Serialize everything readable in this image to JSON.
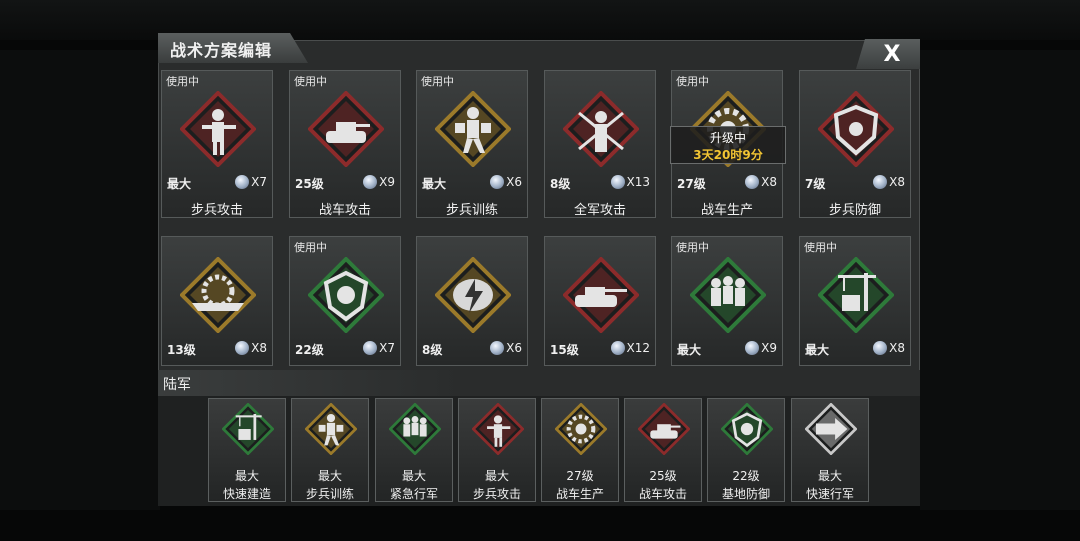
{
  "title": "战术方案编辑",
  "close_label": "X",
  "in_use_label": "使用中",
  "upgrade": {
    "status": "升级中",
    "time": "3天20时9分"
  },
  "army_label": "陆军",
  "colors": {
    "red": "#8c2b2b",
    "gold": "#9b7a2a",
    "green": "#2e7a3a",
    "silver": "#c8c8c8"
  },
  "cards_row1": [
    {
      "in_use": "使用中",
      "level": "最大",
      "count": "X7",
      "name": "步兵攻击",
      "frame": "red",
      "icon": "soldier-aiming-icon"
    },
    {
      "in_use": "使用中",
      "level": "25级",
      "count": "X9",
      "name": "战车攻击",
      "frame": "red",
      "icon": "tank-firing-icon"
    },
    {
      "in_use": "使用中",
      "level": "最大",
      "count": "X6",
      "name": "步兵训练",
      "frame": "gold",
      "icon": "soldier-running-icon"
    },
    {
      "in_use": "",
      "level": "8级",
      "count": "X13",
      "name": "全军攻击",
      "frame": "red",
      "icon": "crossed-rifles-soldier-icon"
    },
    {
      "in_use": "使用中",
      "level": "27级",
      "count": "X8",
      "name": "战车生产",
      "frame": "gold",
      "icon": "gear-production-icon"
    },
    {
      "in_use": "",
      "level": "7级",
      "count": "X8",
      "name": "步兵防御",
      "frame": "red",
      "icon": "shield-defense-icon"
    }
  ],
  "cards_row2": [
    {
      "in_use": "",
      "level": "13级",
      "count": "X8",
      "name": "",
      "frame": "gold",
      "icon": "warship-gear-icon"
    },
    {
      "in_use": "使用中",
      "level": "22级",
      "count": "X7",
      "name": "",
      "frame": "green",
      "icon": "lion-shield-icon"
    },
    {
      "in_use": "",
      "level": "8级",
      "count": "X6",
      "name": "",
      "frame": "gold",
      "icon": "lightning-shield-icon"
    },
    {
      "in_use": "",
      "level": "15级",
      "count": "X12",
      "name": "",
      "frame": "red",
      "icon": "tank-speed-icon"
    },
    {
      "in_use": "使用中",
      "level": "最大",
      "count": "X9",
      "name": "",
      "frame": "green",
      "icon": "soldiers-march-icon"
    },
    {
      "in_use": "使用中",
      "level": "最大",
      "count": "X8",
      "name": "",
      "frame": "green",
      "icon": "crane-construction-icon"
    }
  ],
  "army_slots": [
    {
      "level": "最大",
      "name": "快速建造",
      "frame": "green",
      "icon": "crane-construction-icon"
    },
    {
      "level": "最大",
      "name": "步兵训练",
      "frame": "gold",
      "icon": "soldier-running-icon"
    },
    {
      "level": "最大",
      "name": "紧急行军",
      "frame": "green",
      "icon": "soldiers-march-icon"
    },
    {
      "level": "最大",
      "name": "步兵攻击",
      "frame": "red",
      "icon": "soldier-aiming-icon"
    },
    {
      "level": "27级",
      "name": "战车生产",
      "frame": "gold",
      "icon": "gear-production-icon"
    },
    {
      "level": "25级",
      "name": "战车攻击",
      "frame": "red",
      "icon": "tank-firing-icon"
    },
    {
      "level": "22级",
      "name": "基地防御",
      "frame": "green",
      "icon": "lion-shield-icon"
    },
    {
      "level": "最大",
      "name": "快速行军",
      "frame": "silver",
      "icon": "speed-arrow-icon"
    }
  ]
}
